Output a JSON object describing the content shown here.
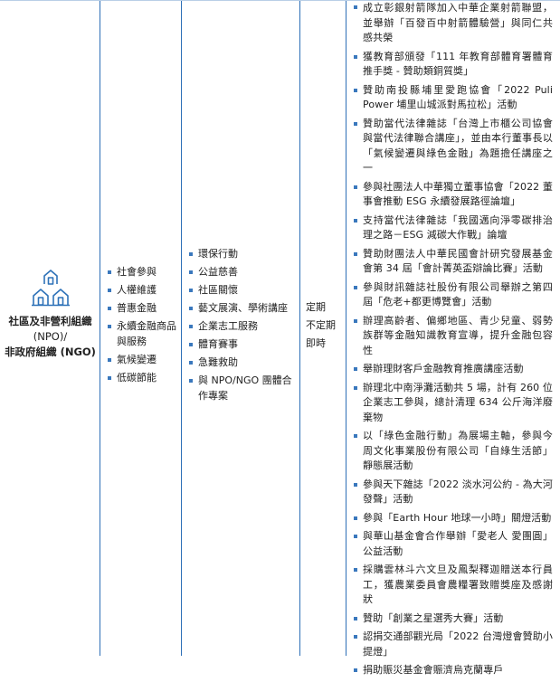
{
  "stakeholder": {
    "icon": "building-icon",
    "name_line1": "社區及非營利組織",
    "name_line2": "(NPO)/",
    "name_line3": "非政府組織 (NGO)"
  },
  "topics": [
    "社會參與",
    "人權維護",
    "普惠金融",
    "永續金融商品與服務",
    "氣候變遷",
    "低碳節能"
  ],
  "channels": [
    "環保行動",
    "公益慈善",
    "社區關懷",
    "藝文展演、學術講座",
    "企業志工服務",
    "體育賽事",
    "急難救助",
    "與 NPO/NGO 團體合作專案"
  ],
  "frequency": [
    "定期",
    "不定期",
    "即時"
  ],
  "actions": [
    "成立彰銀射箭隊加入中華企業射箭聯盟，並舉辦「百發百中射箭體驗營」與同仁共感共榮",
    "獲教育部頒發「111 年教育部體育署體育推手獎 - 贊助類銅質獎」",
    "贊助南投縣埔里愛跑協會「2022 Puli Power 埔里山城派對馬拉松」活動",
    "贊助當代法律雜誌「台灣上市櫃公司協會與當代法律聯合講座」，並由本行董事長以「氣候變遷與綠色金融」為題擔任講座之一",
    "參與社團法人中華獨立董事協會「2022 董事會推動 ESG 永續發展路徑論壇」",
    "支持當代法律雜誌「我國邁向淨零碳排治理之路－ESG 減碳大作戰」論壇",
    "贊助財團法人中華民國會計研究發展基金會第 34 屆「會計菁英盃辯論比賽」活動",
    "參與財訊雜誌社股份有限公司舉辦之第四屆「危老+都更博覽會」活動",
    "辦理高齡者、偏鄉地區、青少兒童、弱勢族群等金融知識教育宣導，提升金融包容性",
    "舉辦理財客戶金融教育推廣講座活動",
    "辦理北中南淨灘活動共 5 場，計有 260 位企業志工參與，總計清理 634 公斤海洋廢棄物",
    "以「綠色金融行動」為展場主軸，參與今周文化事業股份有限公司「自綠生活節」靜態展活動",
    "參與天下雜誌「2022 淡水河公約 - 為大河發聲」活動",
    "參與「Earth Hour 地球一小時」關燈活動",
    "與華山基金會合作舉辦「愛老人 愛團圓」公益活動",
    "採購雲林斗六文旦及鳳梨釋迦贈送本行員工，獲農業委員會農糧署致贈獎座及感謝狀",
    "贊助「創業之星選秀大賽」活動",
    "認捐交通部觀光局「2022 台灣燈會贊助小提燈」",
    "捐助賑災基金會賑濟烏克蘭專戶"
  ],
  "colors": {
    "rule": "#2d6fb7",
    "bullet": "#3a78bd",
    "icon": "#2e72b8"
  }
}
